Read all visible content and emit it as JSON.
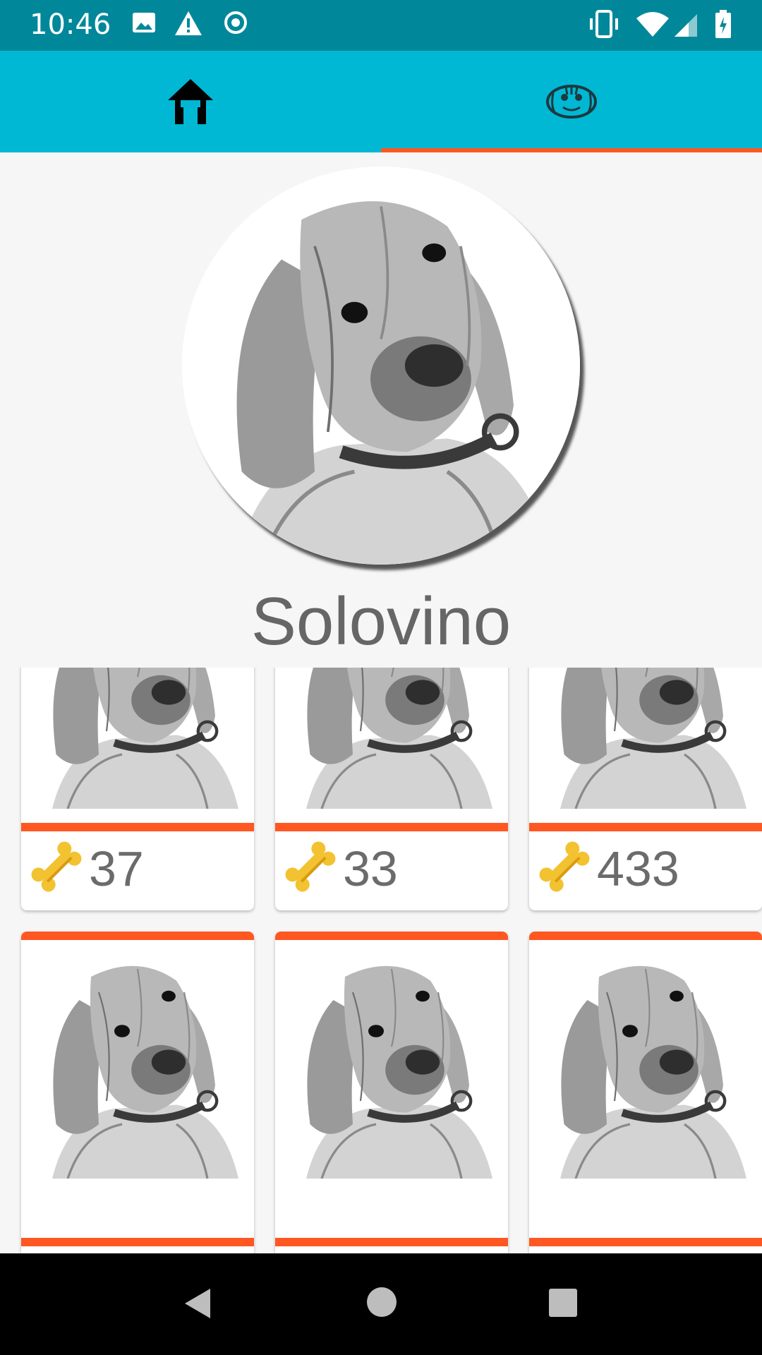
{
  "status_bar": {
    "time": "10:46",
    "icons_left": [
      "image-icon",
      "warning-icon",
      "record-icon"
    ],
    "icons_right": [
      "vibrate-icon",
      "wifi-icon",
      "signal-icon",
      "battery-charging-icon"
    ]
  },
  "tabs": [
    {
      "name": "home",
      "icon": "home-icon",
      "selected": false
    },
    {
      "name": "dog",
      "icon": "dog-face-icon",
      "selected": true
    }
  ],
  "profile": {
    "name": "Solovino"
  },
  "grid": {
    "row1": [
      {
        "icon": "bone-icon",
        "score": "37"
      },
      {
        "icon": "bone-icon",
        "score": "33"
      },
      {
        "icon": "bone-icon",
        "score": "433"
      }
    ],
    "row2": [
      {
        "icon": "bone-icon"
      },
      {
        "icon": "bone-icon"
      },
      {
        "icon": "bone-icon"
      }
    ]
  },
  "colors": {
    "status_bar": "#00889a",
    "tab_bar": "#00b8d4",
    "accent": "#ff5722"
  },
  "nav_bar": [
    "back-button",
    "home-button",
    "recents-button"
  ]
}
